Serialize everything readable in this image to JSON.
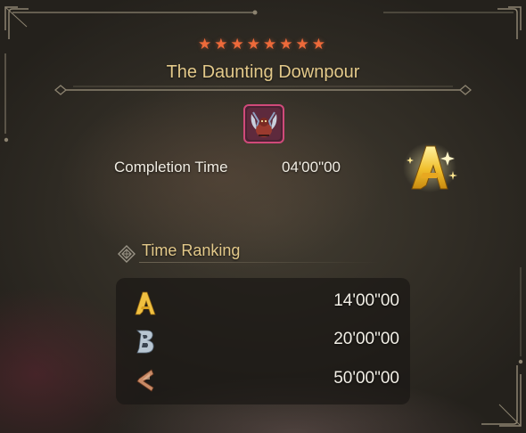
{
  "quest": {
    "stars": "★★★★★★★★",
    "title": "The Daunting Downpour",
    "monster_icon": "rey-dau-monster-icon"
  },
  "result": {
    "completion_label": "Completion Time",
    "completion_time": "04'00\"00",
    "rank": "A"
  },
  "time_ranking": {
    "title": "Time Ranking",
    "tiers": [
      {
        "grade": "A",
        "time": "14'00\"00",
        "color": "#f0c040"
      },
      {
        "grade": "B",
        "time": "20'00\"00",
        "color": "#b8c6d2"
      },
      {
        "grade": "C",
        "time": "50'00\"00",
        "color": "#c98a66"
      }
    ]
  },
  "colors": {
    "accent_gold": "#e3c98a",
    "star_orange": "#ee6a3a",
    "frame_line": "#8c8370"
  }
}
